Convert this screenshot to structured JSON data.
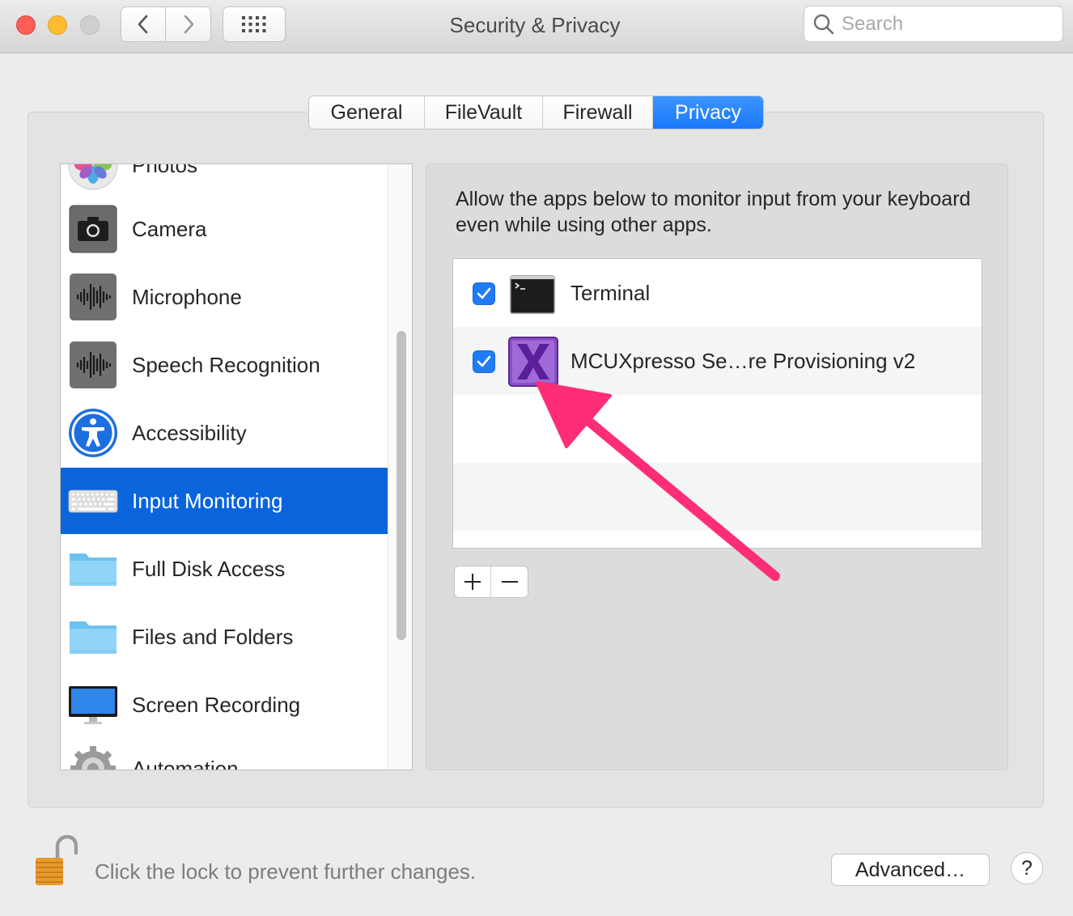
{
  "window": {
    "title": "Security & Privacy",
    "traffic_lights": [
      "close",
      "minimize",
      "zoom"
    ]
  },
  "toolbar": {
    "back_icon": "chevron-left-icon",
    "forward_icon": "chevron-right-icon",
    "grid_icon": "show-all-grid-icon"
  },
  "search": {
    "placeholder": "Search",
    "icon": "search-icon"
  },
  "tabs": [
    {
      "label": "General",
      "selected": false
    },
    {
      "label": "FileVault",
      "selected": false
    },
    {
      "label": "Firewall",
      "selected": false
    },
    {
      "label": "Privacy",
      "selected": true
    }
  ],
  "sidebar": {
    "items": [
      {
        "label": "Photos",
        "icon": "photos-icon",
        "partially_visible": true
      },
      {
        "label": "Camera",
        "icon": "camera-icon"
      },
      {
        "label": "Microphone",
        "icon": "microphone-waveform-icon"
      },
      {
        "label": "Speech Recognition",
        "icon": "speech-waveform-icon"
      },
      {
        "label": "Accessibility",
        "icon": "accessibility-icon"
      },
      {
        "label": "Input Monitoring",
        "icon": "keyboard-icon",
        "selected": true
      },
      {
        "label": "Full Disk Access",
        "icon": "folder-icon"
      },
      {
        "label": "Files and Folders",
        "icon": "folder-icon"
      },
      {
        "label": "Screen Recording",
        "icon": "display-icon"
      },
      {
        "label": "Automation",
        "icon": "gear-icon",
        "partially_visible": true
      }
    ]
  },
  "main": {
    "description": "Allow the apps below to monitor input from your keyboard even while using other apps.",
    "apps": [
      {
        "name": "Terminal",
        "checked": true,
        "icon": "terminal-icon"
      },
      {
        "name": "MCUXpresso Se…re Provisioning v2",
        "checked": true,
        "icon": "mcuxpresso-x-icon"
      }
    ],
    "add_label": "+",
    "remove_label": "−"
  },
  "annotation": {
    "arrow_color": "#ff2d78"
  },
  "footer": {
    "lock_text": "Click the lock to prevent further changes.",
    "advanced_label": "Advanced…",
    "help_label": "?"
  },
  "colors": {
    "accent": "#1a78fb",
    "selection": "#0a64dc"
  }
}
